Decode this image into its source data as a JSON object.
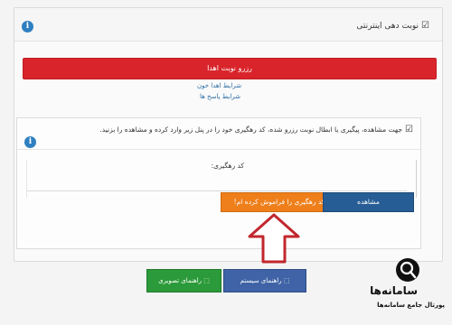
{
  "header": {
    "title": "نوبت دهی اینترنتی",
    "check_icon": "checkbox-icon",
    "info_icon": "info-icon"
  },
  "actions": {
    "reserve_label": "رزرو نوبت اهدا"
  },
  "links": {
    "donor_conditions": "شرایط اهدا خون",
    "faq": "شرایط پاسخ ها"
  },
  "tracking": {
    "instruction": "جهت مشاهده، پیگیری یا ابطال نوبت رزرو شده، کد رهگیری خود را در پنل زیر وارد کرده و مشاهده را بزنید.",
    "field_label": "کد رهگیری:",
    "view_button": "مشاهده",
    "forgot_button": "کد رهگیری را فراموش کرده ام!"
  },
  "guides": {
    "system_guide": "راهنمای سیستم",
    "image_guide": "راهنمای تصویری"
  },
  "watermark": {
    "name": "سامانه‌ها",
    "subtitle": "پورتال جامع سامانه‌ها"
  },
  "colors": {
    "red": "#d9242b",
    "blue": "#275d95",
    "orange": "#ee7f1b",
    "green": "#2b9a3a",
    "navy": "#3f63a6"
  }
}
